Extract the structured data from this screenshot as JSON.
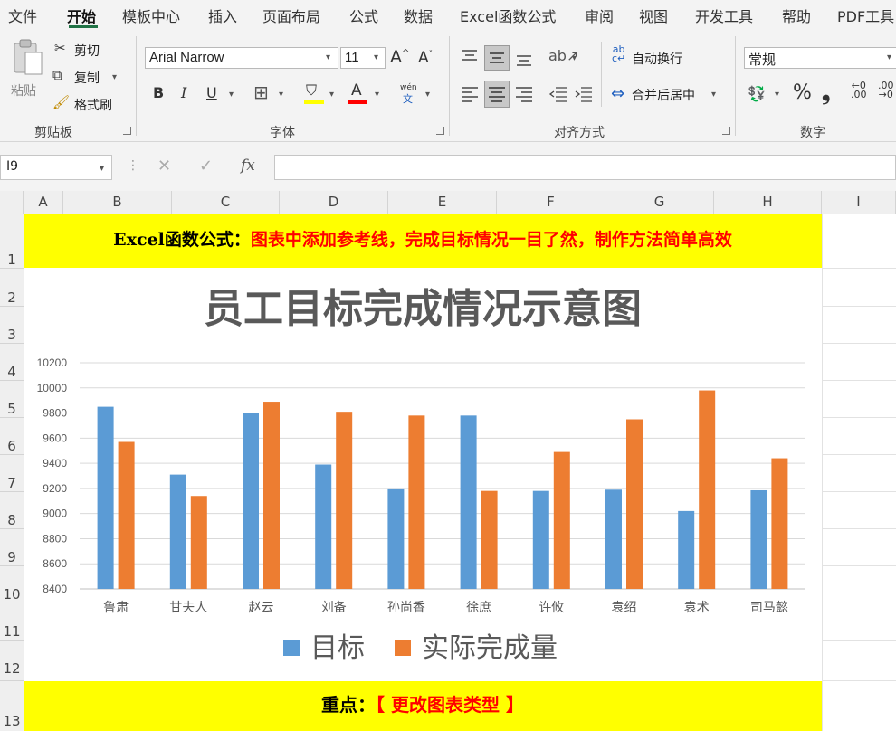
{
  "menu": {
    "items": [
      "文件",
      "开始",
      "模板中心",
      "插入",
      "页面布局",
      "公式",
      "数据",
      "Excel函数公式",
      "审阅",
      "视图",
      "开发工具",
      "帮助",
      "PDF工具"
    ],
    "active": "开始"
  },
  "ribbon": {
    "clipboard": {
      "paste": "粘贴",
      "cut": "剪切",
      "copy": "复制",
      "format_painter": "格式刷",
      "group": "剪贴板"
    },
    "font": {
      "name": "Arial Narrow",
      "size": "11",
      "group": "字体",
      "phonetic": "wén",
      "phonetic_char": "文"
    },
    "alignment": {
      "wrap": "自动换行",
      "merge": "合并后居中",
      "group": "对齐方式"
    },
    "number": {
      "format": "常规",
      "group": "数字"
    }
  },
  "formula_bar": {
    "name_box": "I9",
    "fx": "fx",
    "value": ""
  },
  "sheet": {
    "columns": [
      "A",
      "B",
      "C",
      "D",
      "E",
      "F",
      "G",
      "H",
      "I"
    ],
    "rows": [
      "1",
      "2",
      "3",
      "4",
      "5",
      "6",
      "7",
      "8",
      "9",
      "10",
      "11",
      "12",
      "13"
    ],
    "banner_top": {
      "prefix": "Excel函数公式：",
      "text": "图表中添加参考线，完成目标情况一目了然，制作方法简单高效"
    },
    "banner_bottom": {
      "prefix": "重点：",
      "text": "【 更改图表类型 】"
    }
  },
  "colors": {
    "accent": "#217346",
    "target": "#5B9BD5",
    "actual": "#ED7D31",
    "banner": "#FFFF00",
    "red": "#FF0000"
  },
  "chart_data": {
    "type": "bar",
    "title": "员工目标完成情况示意图",
    "categories": [
      "鲁肃",
      "甘夫人",
      "赵云",
      "刘备",
      "孙尚香",
      "徐庶",
      "许攸",
      "袁绍",
      "袁术",
      "司马懿"
    ],
    "series": [
      {
        "name": "目标",
        "values": [
          9850,
          9310,
          9800,
          9390,
          9200,
          9780,
          9180,
          9190,
          9020,
          9185
        ]
      },
      {
        "name": "实际完成量",
        "values": [
          9570,
          9140,
          9890,
          9810,
          9780,
          9180,
          9490,
          9750,
          9980,
          9440
        ]
      }
    ],
    "ylim": [
      8400,
      10200
    ],
    "yticks": [
      "8400",
      "8600",
      "8800",
      "9000",
      "9200",
      "9400",
      "9600",
      "9800",
      "10000",
      "10200"
    ],
    "grid": true,
    "legend": "bottom"
  }
}
